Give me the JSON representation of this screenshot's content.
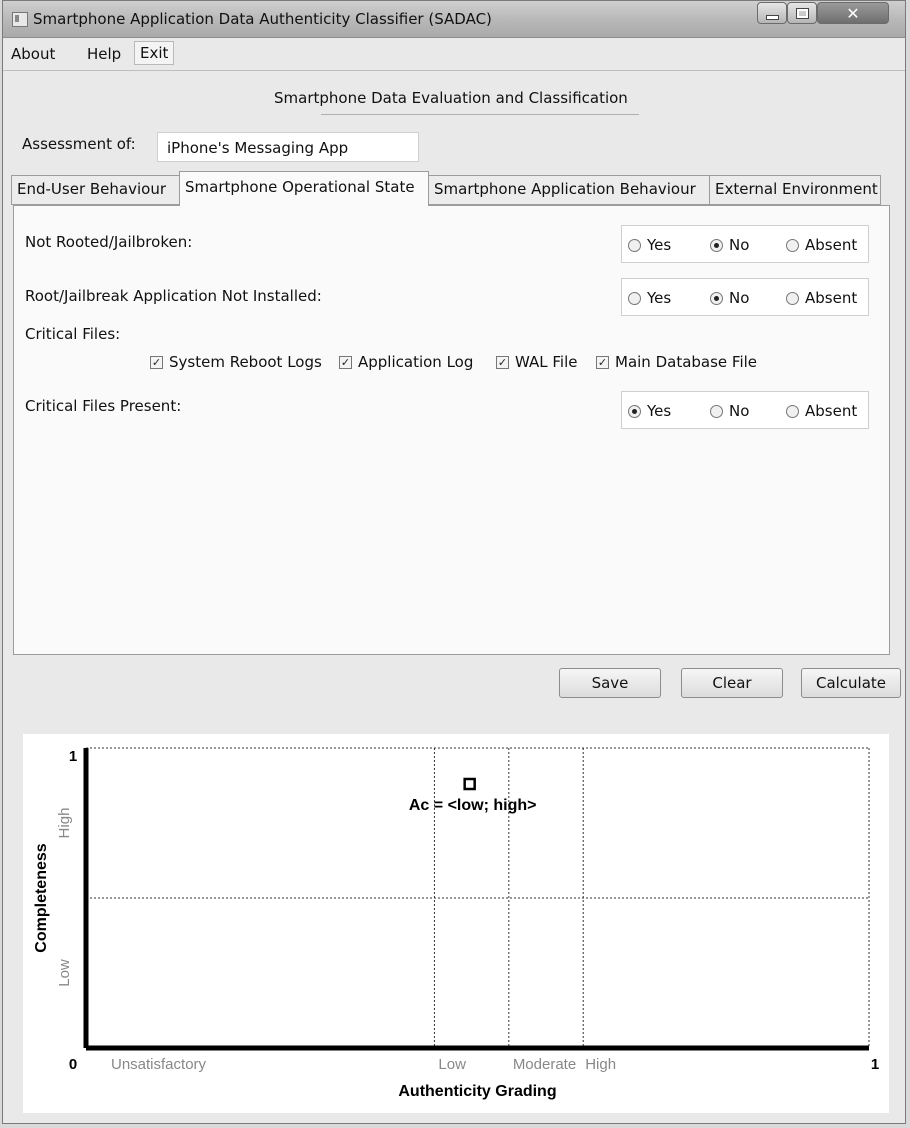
{
  "window": {
    "title": "Smartphone Application Data Authenticity Classifier (SADAC)"
  },
  "menu": {
    "about": "About",
    "help": "Help",
    "exit": "Exit"
  },
  "header": {
    "section_title": "Smartphone Data Evaluation and Classification"
  },
  "assessment": {
    "label": "Assessment of:",
    "value": "iPhone's Messaging App"
  },
  "tabs": [
    {
      "label": "End-User Behaviour"
    },
    {
      "label": "Smartphone Operational State"
    },
    {
      "label": "Smartphone Application Behaviour"
    },
    {
      "label": "External Environment"
    }
  ],
  "questions": [
    {
      "label": "Not Rooted/Jailbroken:",
      "selected": "No"
    },
    {
      "label": "Root/Jailbreak Application Not Installed:",
      "selected": "No"
    },
    {
      "label": "Critical Files Present:",
      "selected": "Yes"
    }
  ],
  "options": {
    "yes": "Yes",
    "no": "No",
    "absent": "Absent"
  },
  "critical_files": {
    "label": "Critical Files:",
    "items": [
      {
        "label": "System Reboot Logs",
        "checked": true
      },
      {
        "label": "Application Log",
        "checked": true
      },
      {
        "label": "WAL File",
        "checked": true
      },
      {
        "label": "Main Database File",
        "checked": true
      }
    ]
  },
  "buttons": {
    "save": "Save",
    "clear": "Clear",
    "calculate": "Calculate"
  },
  "chart_data": {
    "type": "scatter",
    "xlabel": "Authenticity Grading",
    "ylabel": "Completeness",
    "xlim": [
      0,
      1
    ],
    "ylim": [
      0,
      1
    ],
    "x_tick_labels": [
      "0",
      "1"
    ],
    "y_tick_labels": [
      "0",
      "1"
    ],
    "x_bands": [
      {
        "label": "Unsatisfactory",
        "from": 0,
        "to": 0.445
      },
      {
        "label": "Low",
        "from": 0.445,
        "to": 0.54
      },
      {
        "label": "Moderate",
        "from": 0.54,
        "to": 0.635
      },
      {
        "label": "High",
        "from": 0.635,
        "to": 1
      }
    ],
    "y_bands": [
      {
        "label": "Low",
        "from": 0,
        "to": 0.5
      },
      {
        "label": "High",
        "from": 0.5,
        "to": 1
      }
    ],
    "points": [
      {
        "x": 0.49,
        "y": 0.88,
        "annotation": "Ac = <low; high>"
      }
    ],
    "grid": "dotted band dividers"
  }
}
